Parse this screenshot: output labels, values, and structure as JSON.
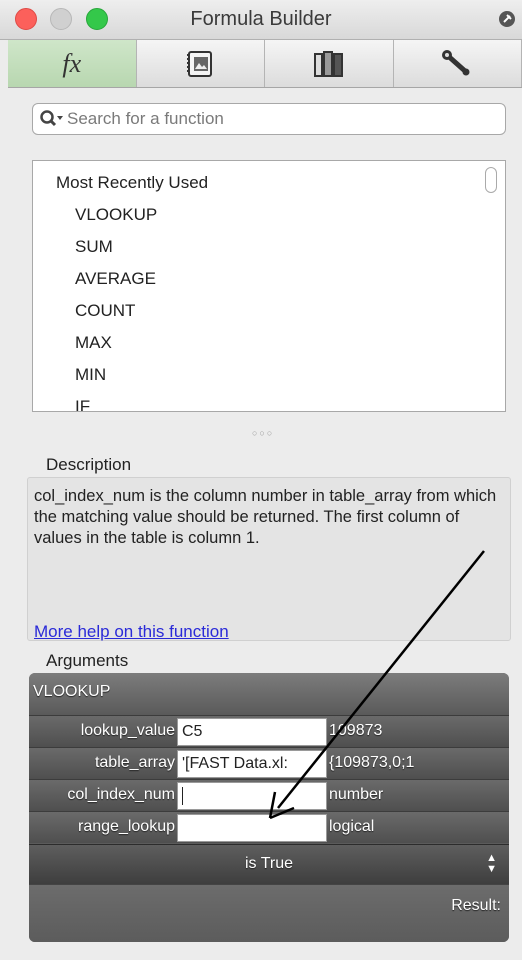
{
  "window": {
    "title": "Formula Builder"
  },
  "toolbar": {
    "tabs": [
      {
        "label": "fx",
        "icon": "function-icon"
      },
      {
        "label": "",
        "icon": "media-browser-icon"
      },
      {
        "label": "",
        "icon": "library-icon"
      },
      {
        "label": "",
        "icon": "wrench-icon"
      }
    ],
    "active_color": "#bcd9b4"
  },
  "search": {
    "placeholder": "Search for a function"
  },
  "function_list": {
    "group": "Most Recently Used",
    "items": [
      "VLOOKUP",
      "SUM",
      "AVERAGE",
      "COUNT",
      "MAX",
      "MIN",
      "IF"
    ]
  },
  "description": {
    "label": "Description",
    "text": "col_index_num is the column number in table_array from which the matching value should be returned. The first column of values in the table is column 1.",
    "help_link": "More help on this function"
  },
  "arguments": {
    "label": "Arguments",
    "function_name": "VLOOKUP",
    "rows": [
      {
        "name": "lookup_value",
        "value": "C5",
        "result": "109873"
      },
      {
        "name": "table_array",
        "value": "'[FAST Data.xl:",
        "result": "{109873,0;1"
      },
      {
        "name": "col_index_num",
        "value": "",
        "result": "number"
      },
      {
        "name": "range_lookup",
        "value": "",
        "result": "logical"
      }
    ],
    "select_value": "is True",
    "result_label": "Result:"
  }
}
